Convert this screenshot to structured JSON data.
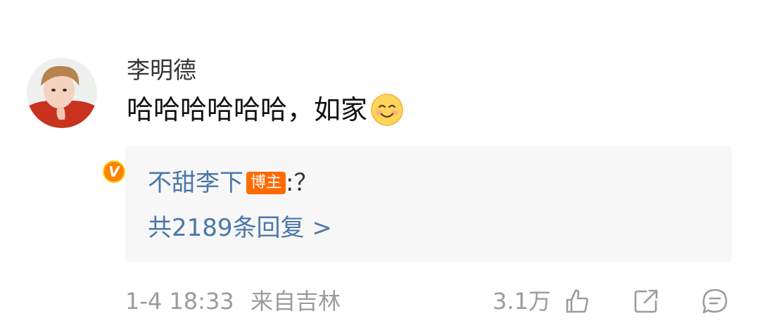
{
  "comment": {
    "username": "李明德",
    "text": "哈哈哈哈哈哈，如家",
    "emoji": "smile-emoji",
    "verified_badge": "V",
    "reply": {
      "author": "不甜李下",
      "badge": "博主",
      "content": ":？",
      "count_text": "共2189条回复 >"
    },
    "footer": {
      "timestamp": "1-4 18:33",
      "location": "来自吉林",
      "like_count": "3.1万"
    }
  },
  "colors": {
    "link": "#4a78a8",
    "badge": "#ff6a00",
    "verified": "#ff8200",
    "meta": "#9b9b9b"
  }
}
